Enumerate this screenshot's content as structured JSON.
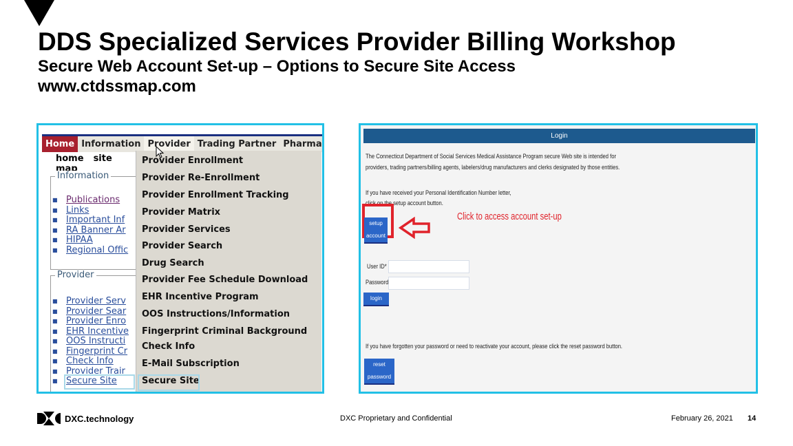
{
  "slide": {
    "title": "DDS Specialized Services Provider Billing Workshop",
    "subtitle": "Secure Web Account Set-up – Options to Secure Site Access",
    "url": "www.ctdssmap.com"
  },
  "left_screenshot": {
    "nav": [
      "Home",
      "Information",
      "Provider",
      "Trading Partner",
      "Pharmacy In"
    ],
    "subnav": [
      "home",
      "site map"
    ],
    "information_legend": "Information",
    "information_links": [
      "Publications",
      "Links",
      "Important Inf",
      "RA Banner Ar",
      "HIPAA",
      "Regional Offic"
    ],
    "provider_legend": "Provider",
    "provider_links": [
      "Provider Serv",
      "Provider Sear",
      "Provider Enro",
      "EHR Incentive",
      "OOS Instructi",
      "Fingerprint Cr",
      "Check Info",
      "Provider Trair",
      "Secure Site"
    ],
    "dropdown": [
      "Provider Enrollment",
      "Provider Re-Enrollment",
      "Provider Enrollment Tracking",
      "Provider Matrix",
      "Provider Services",
      "Provider Search",
      "Drug Search",
      "Provider Fee Schedule Download",
      "EHR Incentive Program",
      "OOS Instructions/Information",
      "Fingerprint Criminal Background",
      "Check Info",
      "E-Mail Subscription",
      "Secure Site"
    ]
  },
  "right_screenshot": {
    "header": "Login",
    "intro1": "The Connecticut Department of Social Services Medical Assistance Program secure Web site is intended for",
    "intro2": "providers, trading partners/billing agents, labelers/drug manufacturers and clerks designated by those entities.",
    "pin1": "If you have received your Personal Identification Number letter,",
    "pin2": "click on the setup account button.",
    "setup_button": "setup account",
    "callout": "Click to access account set-up",
    "userid_label": "User ID*",
    "password_label": "Password*",
    "login_button": "login",
    "forgot": "If you have forgotten your password or need to reactivate your account, please click the reset password button.",
    "reset_button": "reset password",
    "accent": "#e0232b"
  },
  "footer": {
    "logo": "DXC.technology",
    "confidential": "DXC Proprietary and Confidential",
    "date": "February 26, 2021",
    "page": "14"
  }
}
